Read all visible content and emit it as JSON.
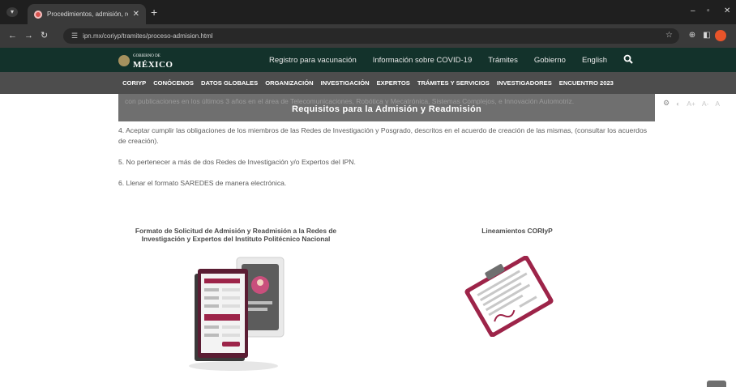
{
  "browser": {
    "tab_title": "Procedimientos, admisión, ree",
    "tab_close": "✕",
    "new_tab": "+",
    "url": "ipn.mx/coriyp/tramites/proceso-admision.html",
    "window_controls": [
      "–",
      "▫",
      "✕"
    ]
  },
  "gov_header": {
    "logo_small": "GOBIERNO DE",
    "logo_main": "MÉXICO",
    "links": [
      "Registro para vacunación",
      "Información sobre COVID-19",
      "Trámites",
      "Gobierno",
      "English"
    ],
    "search_icon": "search-icon"
  },
  "main_nav": {
    "items": [
      "CORIYP",
      "CONÓCENOS",
      "DATOS GLOBALES",
      "ORGANIZACIÓN",
      "INVESTIGACIÓN",
      "EXPERTOS",
      "TRÁMITES Y SERVICIOS",
      "INVESTIGADORES",
      "ENCUENTRO 2023"
    ]
  },
  "banner": {
    "title": "Requisitos para la Admisión y Readmisión",
    "background_text": "con publicaciones en los últimos 3 años en el área de Telecomunicaciones, Robótica y Mecatrónica, Sistemas Complejos, e Innovación Automotriz."
  },
  "a11y": {
    "contrast": "◐",
    "larger": "A+",
    "smaller": "A-",
    "reset": "A"
  },
  "requirements": [
    "4. Aceptar cumplir las obligaciones de los miembros de las Redes de Investigación y Posgrado, descritos en el acuerdo de creación de las mismas, (consultar los acuerdos de creación).",
    "5. No pertenecer a más de dos Redes de Investigación y/o Expertos del IPN.",
    "6. Llenar el formato SAREDES de manera electrónica."
  ],
  "cards": {
    "form_title": "Formato de Solicitud de Admisión y Readmisión a la Redes de Investigación y Expertos del Instituto Politécnico Nacional",
    "guidelines_title": "Lineamientos CORIyP"
  },
  "colors": {
    "gov_green": "#13322b",
    "nav_gray": "#4d4d4d",
    "brand_maroon": "#9d2449"
  }
}
